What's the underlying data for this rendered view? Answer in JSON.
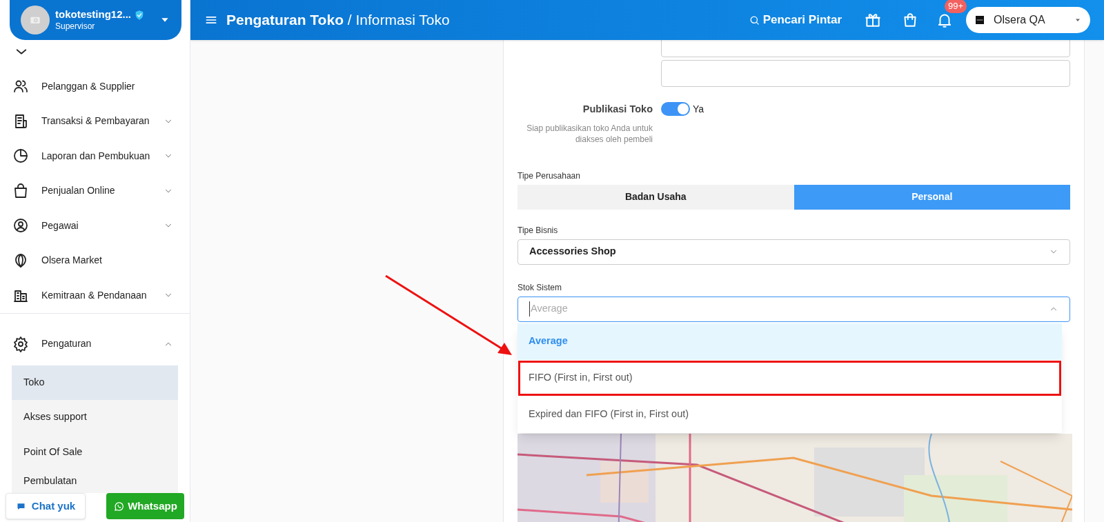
{
  "user": {
    "name": "tokotesting12...",
    "role": "Supervisor"
  },
  "header": {
    "title": "**Pengaturan Toko** / Informasi Toko",
    "search_label": "Pencari Pintar",
    "notification_badge": "99+",
    "store": "Olsera QA"
  },
  "sidebar": {
    "items": [
      {
        "label": "Pelanggan & Supplier",
        "expandable": false
      },
      {
        "label": "Transaksi & Pembayaran",
        "expandable": true,
        "expanded": false
      },
      {
        "label": "Laporan dan Pembukuan",
        "expandable": true,
        "expanded": false
      },
      {
        "label": "Penjualan Online",
        "expandable": true,
        "expanded": false
      },
      {
        "label": "Pegawai",
        "expandable": true,
        "expanded": false
      },
      {
        "label": "Olsera Market",
        "expandable": false
      },
      {
        "label": "Kemitraan & Pendanaan",
        "expandable": true,
        "expanded": false
      },
      {
        "label": "Pengaturan",
        "expandable": true,
        "expanded": true,
        "children": [
          {
            "label": "Toko",
            "selected": true
          },
          {
            "label": "Akses support",
            "selected": false
          },
          {
            "label": "Point Of Sale",
            "selected": false
          },
          {
            "label": "Pembulatan",
            "selected": false
          }
        ]
      }
    ]
  },
  "form": {
    "publish": {
      "label": "Publikasi Toko",
      "description": "Siap publikasikan toko Anda untuk diakses oleh pembeli",
      "on": true,
      "value_label": "Ya"
    },
    "company_type": {
      "label": "Tipe Perusahaan",
      "options": [
        {
          "label": "Badan Usaha",
          "selected": false
        },
        {
          "label": "Personal",
          "selected": true
        }
      ]
    },
    "business_type": {
      "label": "Tipe Bisnis",
      "value": "Accessories Shop"
    },
    "stock_system": {
      "label": "Stok Sistem",
      "placeholder": "Average",
      "open": true,
      "options": [
        {
          "label": "Average",
          "selected": true,
          "highlighted": false
        },
        {
          "label": "FIFO (First in, First out)",
          "selected": false,
          "highlighted": true
        },
        {
          "label": "Expired dan FIFO (First in, First out)",
          "selected": false,
          "highlighted": false
        }
      ]
    }
  },
  "footer_buttons": [
    {
      "label": "Chat yuk",
      "kind": "chat"
    },
    {
      "label": "Whatsapp",
      "kind": "whatsapp"
    }
  ]
}
